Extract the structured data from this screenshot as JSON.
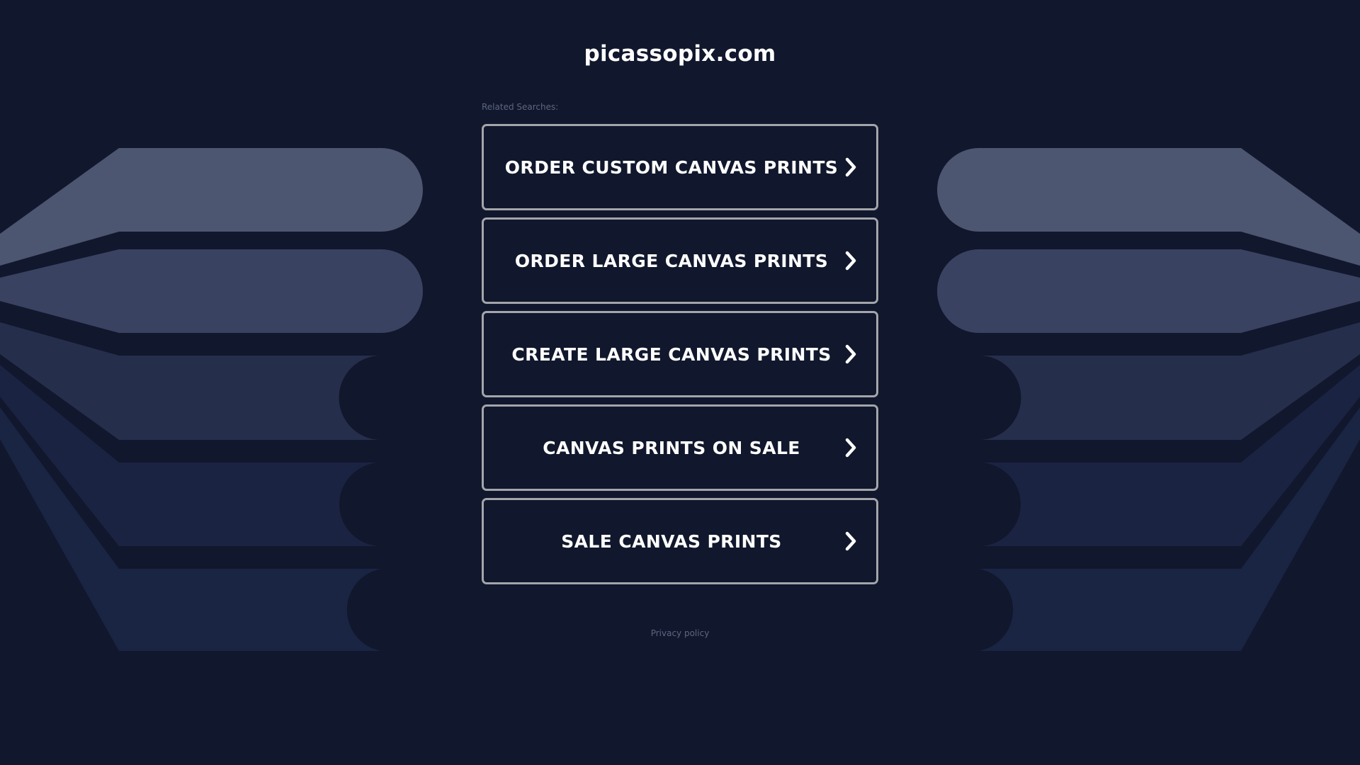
{
  "site": {
    "domain": "picassopix.com"
  },
  "related": {
    "label": "Related Searches:",
    "items": [
      {
        "label": "ORDER CUSTOM CANVAS PRINTS"
      },
      {
        "label": "ORDER LARGE CANVAS PRINTS"
      },
      {
        "label": "CREATE LARGE CANVAS PRINTS"
      },
      {
        "label": "CANVAS PRINTS ON SALE"
      },
      {
        "label": "SALE CANVAS PRINTS"
      }
    ]
  },
  "footer": {
    "privacy_label": "Privacy policy"
  },
  "icons": {
    "result_arrow": "chevron-right-icon"
  },
  "colors": {
    "background": "#11172c",
    "button_border": "#a3a5aa",
    "text": "#ffffff",
    "muted_text": "#5c6781",
    "shape_1": "#4d5670",
    "shape_2": "#394260",
    "shape_3": "#252e4b",
    "shape_4": "#1b2342",
    "shape_5": "#1a2443"
  }
}
